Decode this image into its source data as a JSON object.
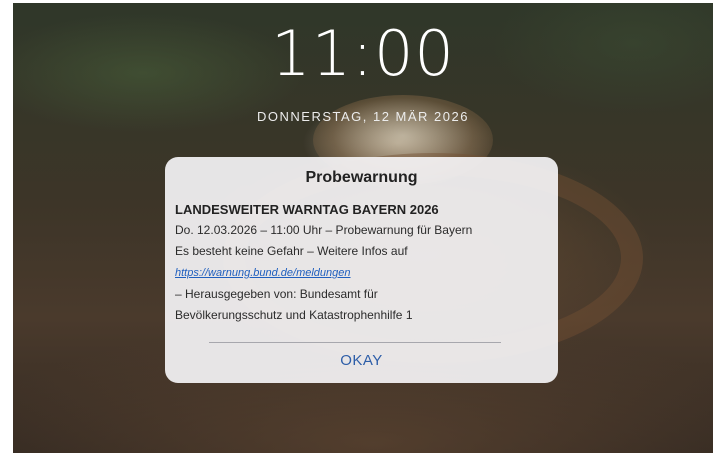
{
  "lockscreen": {
    "time": "11:00",
    "date": "DONNERSTAG, 12 MÄR 2026"
  },
  "alert": {
    "title": "Probewarnung",
    "heading": "LANDESWEITER WARNTAG BAYERN 2026",
    "line1": "Do. 12.03.2026 – 11:00 Uhr – Probewarnung für Bayern",
    "line2": "Es besteht keine Gefahr – Weitere Infos auf",
    "link": "https://warnung.bund.de/meldungen",
    "line3": "– Herausgegeben von: Bundesamt für",
    "line4": "Bevölkerungsschutz und Katastrophenhilfe 1",
    "button_label": "OKAY"
  },
  "colors": {
    "button": "#2e5ea8",
    "link": "#1f5fbf",
    "alert_background": "#f5f4f6"
  }
}
